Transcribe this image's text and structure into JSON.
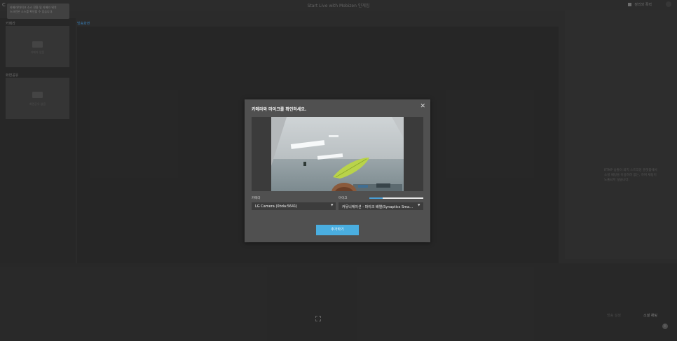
{
  "app": {
    "corner_letter": "C",
    "title": "Start Live with Mobizen 인게임",
    "account_label": "정리와 폭력"
  },
  "tooltip": {
    "lines": [
      "카메라/마이크 소스 전환 및 카메라 위치",
      "스크린은 소스를 확인할 수 있습니다."
    ]
  },
  "left_panel": {
    "camera_section_label": "카메라",
    "camera_tile_text": "카메라 없음",
    "screen_section_label": "화면공유",
    "screen_tile_text": "화면공유 없음"
  },
  "tabs": {
    "active": "방송화면"
  },
  "right_panel": {
    "info_lines": [
      "RTMP 송출이 되지 스트리밍 플랫폼에서",
      "소셜 채팅을 이용하려 없는, 하여 채팅이",
      "노출되지 않습니다."
    ]
  },
  "bottom_bar": {
    "secondary_button": "방송 설정",
    "live_button": "소셜 채팅",
    "help_icon": "i"
  },
  "modal": {
    "title": "카메라와 마이크를 확인하세요.",
    "close_icon": "close-icon",
    "camera_label": "카메라",
    "camera_value": "LG Camera (0bda:5641)",
    "mic_label": "마이크",
    "mic_level": 0.25,
    "mic_value": "커뮤니케이션 - 마이크 배열(Synaptics SmartAudio HD)",
    "add_button": "추가하기"
  },
  "colors": {
    "accent": "#4aaee0",
    "modal_bg": "#505050",
    "page_bg": "#2f2f2f"
  }
}
